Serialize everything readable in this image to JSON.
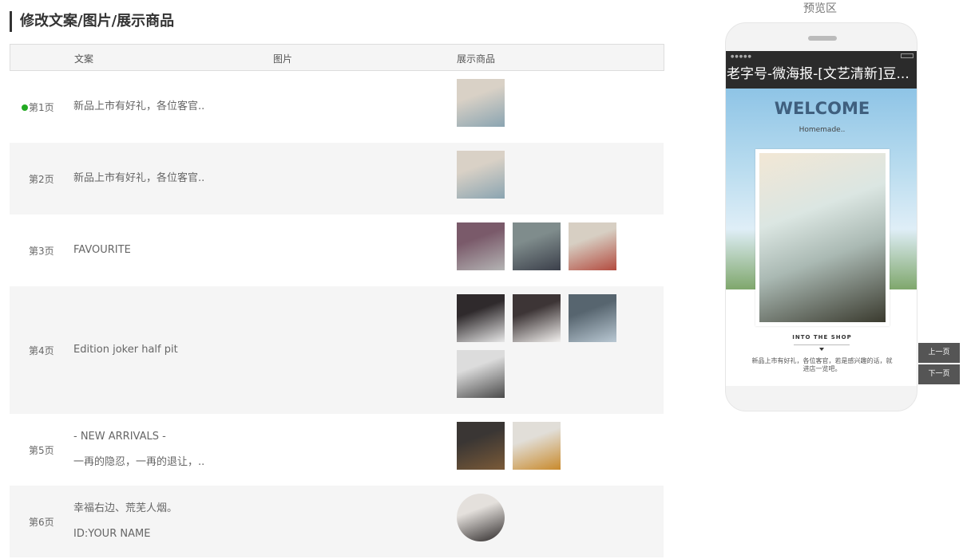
{
  "editor": {
    "title": "修改文案/图片/展示商品",
    "columns": [
      "文案",
      "图片",
      "展示商品"
    ],
    "rows": [
      {
        "page": "第1页",
        "active": true,
        "copy": [
          "新品上市有好礼，各位客官.."
        ],
        "thumbs": [
          [
            "#d9d1c6",
            "#8aa4b1"
          ]
        ]
      },
      {
        "page": "第2页",
        "active": false,
        "copy": [
          "新品上市有好礼，各位客官.."
        ],
        "thumbs": [
          [
            "#d9d1c6",
            "#8aa4b1"
          ]
        ]
      },
      {
        "page": "第3页",
        "active": false,
        "copy": [
          "FAVOURITE"
        ],
        "thumbs": [
          [
            "#7a5a6a",
            "#b4b4b4"
          ],
          [
            "#7f8c8c",
            "#3b3f4a"
          ],
          [
            "#d7cfc3",
            "#b34b3f"
          ]
        ]
      },
      {
        "page": "第4页",
        "active": false,
        "copy": [
          "Edition joker half pit"
        ],
        "thumbs": [
          [
            "#2f2a2c",
            "#e7e7e7"
          ],
          [
            "#3d3536",
            "#f3f1ef"
          ],
          [
            "#57656f",
            "#b9c8d3"
          ],
          [
            "#dcdcdc",
            "#4a4a4a"
          ]
        ]
      },
      {
        "page": "第5页",
        "active": false,
        "copy": [
          "- NEW ARRIVALS -",
          "一再的隐忍，一再的退让，.."
        ],
        "thumbs": [
          [
            "#3a3634",
            "#7a5a38"
          ],
          [
            "#e1ded8",
            "#c98a2c"
          ]
        ]
      },
      {
        "page": "第6页",
        "active": false,
        "copy": [
          "幸福右边、荒芜人烟。",
          "ID:YOUR NAME"
        ],
        "thumbs": [
          [
            "#e4e0dc",
            "#2e2a2a"
          ]
        ],
        "round": true
      }
    ]
  },
  "preview": {
    "label": "预览区",
    "nav_title": "老字号-微海报-[文艺清新]豆...",
    "welcome": "WELCOME",
    "homemade": "Homemade..",
    "shop": "INTO THE SHOP",
    "desc": "新品上市有好礼，各位客官，若是感兴趣的话，就进店一览吧。",
    "prev_button": "上一页",
    "next_button": "下一页"
  }
}
